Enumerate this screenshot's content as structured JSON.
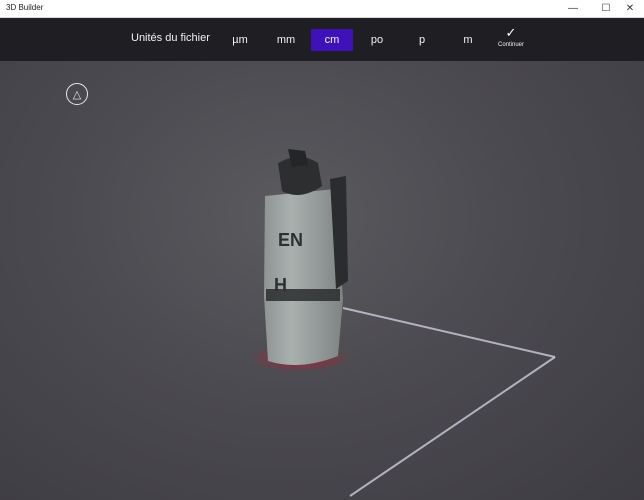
{
  "window": {
    "title": "3D Builder",
    "min_icon": "minimize-icon",
    "max_icon": "maximize-icon",
    "close_icon": "close-icon"
  },
  "toolbar": {
    "units_label": "Unités du fichier",
    "units": [
      "µm",
      "mm",
      "cm",
      "po",
      "p",
      "m"
    ],
    "selected_unit": "cm",
    "continue_label": "Continuer",
    "continue_icon": "checkmark-icon"
  },
  "colors": {
    "accent": "#3e12b8",
    "toolbar_bg": "#1f1f23",
    "grid_line": "#d9d4e6",
    "base_glow": "#c01830"
  },
  "viewport": {
    "nav_icon": "view-cube-icon",
    "object_label_1": "EN",
    "object_label_2": "H"
  }
}
